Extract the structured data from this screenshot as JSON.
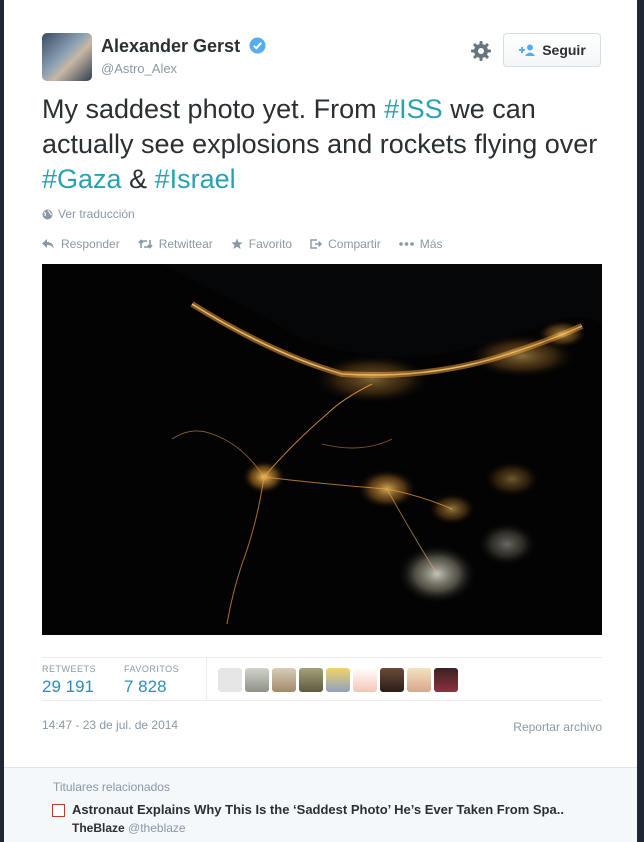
{
  "tweet": {
    "author_name": "Alexander Gerst",
    "author_handle": "@Astro_Alex",
    "follow_label": "Seguir",
    "text_parts": [
      {
        "text": "My saddest photo yet. From ",
        "tag": false
      },
      {
        "text": "#ISS",
        "tag": true
      },
      {
        "text": " we can actually see explosions and rockets flying over ",
        "tag": false
      },
      {
        "text": "#Gaza",
        "tag": true
      },
      {
        "text": " & ",
        "tag": false
      },
      {
        "text": "#Israel",
        "tag": true
      }
    ],
    "translate_label": "Ver traducción",
    "actions": {
      "reply": "Responder",
      "retweet": "Retwittear",
      "favorite": "Favorito",
      "share": "Compartir",
      "more": "Más"
    },
    "stats": {
      "retweets_label": "RETWEETS",
      "retweets_value": "29 191",
      "favorites_label": "FAVORITOS",
      "favorites_value": "7 828"
    },
    "timestamp": "14:47 - 23 de jul. de 2014",
    "report_label": "Reportar archivo"
  },
  "related": {
    "heading": "Titulares relacionados",
    "title": "Astronaut Explains Why This Is the ‘Saddest Photo’ He’s Ever Taken From Spa..",
    "source_name": "TheBlaze",
    "source_handle": "@theblaze"
  },
  "icons": {
    "verified": "verified-badge-icon",
    "gear": "gear-icon",
    "follow": "follow-user-icon",
    "globe": "globe-icon",
    "reply": "reply-icon",
    "retweet": "retweet-icon",
    "favorite": "star-icon",
    "share": "share-icon",
    "more": "more-dots-icon"
  },
  "colors": {
    "hashtag": "#2aa1b1",
    "stat_value": "#2a8eb8",
    "verified": "#55acee"
  }
}
